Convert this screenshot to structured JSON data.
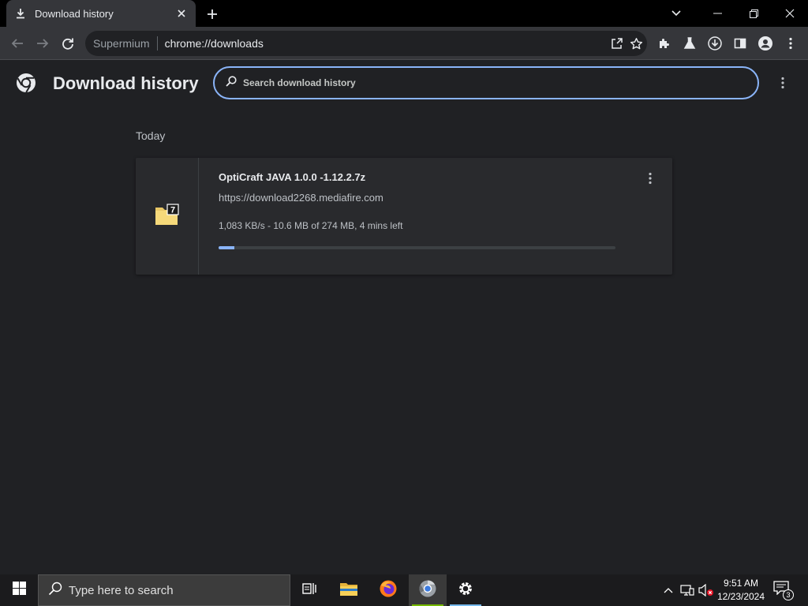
{
  "browser": {
    "tab": {
      "title": "Download history"
    },
    "omnibox": {
      "site_name": "Supermium",
      "url": "chrome://downloads"
    }
  },
  "page": {
    "title": "Download history",
    "search": {
      "placeholder": "Search download history",
      "value": ""
    }
  },
  "downloads": {
    "section_label": "Today",
    "items": [
      {
        "file_name": "OptiCraft JAVA 1.0.0 -1.12.2.7z",
        "source_url": "https://download2268.mediafire.com",
        "status": "1,083 KB/s - 10.6 MB of 274 MB, 4 mins left",
        "progress_percent": 3.9,
        "icon": "7zip-archive-icon"
      }
    ]
  },
  "taskbar": {
    "search_placeholder": "Type here to search",
    "time": "9:51 AM",
    "date": "12/23/2024",
    "notification_count": "3"
  },
  "colors": {
    "accent": "#8ab4f8",
    "page_bg": "#202124",
    "card_bg": "#292a2d",
    "toolbar_bg": "#35363a"
  }
}
